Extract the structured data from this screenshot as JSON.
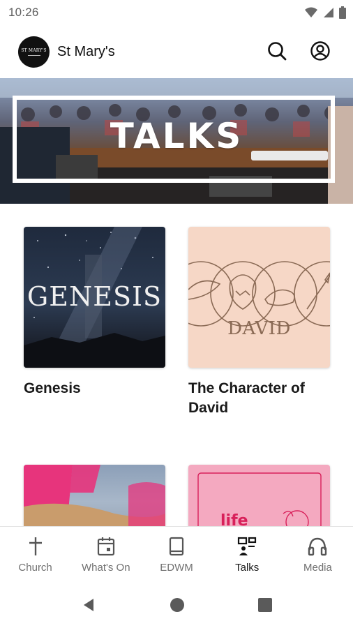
{
  "status_bar": {
    "time": "10:26",
    "icons": [
      "wifi-icon",
      "signal-icon",
      "battery-icon"
    ]
  },
  "app_bar": {
    "logo_text": "ST MARY'S",
    "title": "St Mary's",
    "actions": [
      "search-icon",
      "account-icon"
    ]
  },
  "hero": {
    "title": "TALKS"
  },
  "cards": [
    {
      "title": "Genesis",
      "cover_text": "GENESIS"
    },
    {
      "title": "The Character of David",
      "cover_text": "DAVID"
    },
    {
      "title": "",
      "cover_text": ""
    },
    {
      "title": "",
      "cover_text": "life"
    }
  ],
  "bottom_nav": {
    "items": [
      {
        "label": "Church",
        "icon": "cross-icon"
      },
      {
        "label": "What's On",
        "icon": "calendar-icon"
      },
      {
        "label": "EDWM",
        "icon": "book-icon"
      },
      {
        "label": "Talks",
        "icon": "talks-icon"
      },
      {
        "label": "Media",
        "icon": "headphones-icon"
      }
    ],
    "active": "Talks"
  },
  "colors": {
    "active_nav": "#1a1a1a",
    "inactive_nav": "#707070",
    "david_bg": "#f6d7c6",
    "pink_card": "#f4a9c0"
  }
}
